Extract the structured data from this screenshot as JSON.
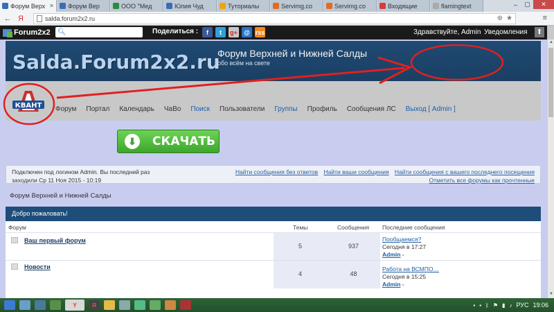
{
  "browser": {
    "tabs": [
      {
        "label": "Форум Верх",
        "active": true
      },
      {
        "label": "Форум Вер"
      },
      {
        "label": "ООО \"Мед"
      },
      {
        "label": "Юлия Чуд"
      },
      {
        "label": "Туториалы"
      },
      {
        "label": "Servimg.co"
      },
      {
        "label": "Servimg.co"
      },
      {
        "label": "Входящие"
      },
      {
        "label": "flamingtext"
      }
    ],
    "url": "salda.forum2x2.ru",
    "back_icon": "back-arrow-icon",
    "yandex_icon": "yandex-icon",
    "menu_icon": "hamburger-menu-icon"
  },
  "forumbar": {
    "brand": "Forum2x2",
    "search_placeholder": "",
    "share_label": "Поделиться :",
    "social": [
      "f",
      "t",
      "g+",
      "@",
      "rss"
    ],
    "greeting": "Здравствуйте, Admin",
    "notifications": "Уведомления"
  },
  "header": {
    "logo_text": "Salda.Forum2x2.ru",
    "title": "Форум Верхней и Нижней Салды",
    "description": "обо всём на свете",
    "kvant_logo_text": "КВАНТ"
  },
  "menu": [
    {
      "label": "Форум",
      "highlight": false
    },
    {
      "label": "Портал",
      "highlight": false
    },
    {
      "label": "Календарь",
      "highlight": false
    },
    {
      "label": "ЧаВо",
      "highlight": false
    },
    {
      "label": "Поиск",
      "highlight": true
    },
    {
      "label": "Пользователи",
      "highlight": false
    },
    {
      "label": "Группы",
      "highlight": true
    },
    {
      "label": "Профиль",
      "highlight": false
    },
    {
      "label": "Сообщения ЛС",
      "highlight": false
    },
    {
      "label": "Выход [ Admin ]",
      "highlight": true
    }
  ],
  "download_button": "СКАЧАТЬ",
  "login": {
    "line1": "Подключен под логином Admin. Вы последний раз",
    "line2": "заходили Ср 11 Ноя 2015 - 10:19",
    "links": [
      "Найти сообщения без ответов",
      "Найти ваши сообщения",
      "Найти сообщения с вашего последнего посещения"
    ],
    "mark_read": "Отметить все форумы как прочтенные"
  },
  "breadcrumb": "Форум Верхней и Нижней Салды",
  "forum_table": {
    "welcome": "Добро пожаловать!",
    "headers": [
      "Форум",
      "Темы",
      "Сообщения",
      "Последние сообщения"
    ],
    "rows": [
      {
        "name": "Ваш первый форум",
        "topics": "5",
        "posts": "937",
        "last_title": "Пообщаемся?",
        "last_time": "Сегодня в 17:27",
        "last_user": "Admin"
      },
      {
        "name": "Новости",
        "topics": "4",
        "posts": "48",
        "last_title": "Работа на ВСМПО…",
        "last_time": "Сегодня в 15:25",
        "last_user": "Admin"
      }
    ]
  },
  "taskbar": {
    "language": "РУС",
    "clock": "19:06"
  },
  "colors": {
    "banner": "#1f4a73",
    "forum_header": "#1e4d7a",
    "page_bg": "#c8cdf0",
    "annotation_red": "#e02020",
    "download_green": "#3ea62e"
  }
}
